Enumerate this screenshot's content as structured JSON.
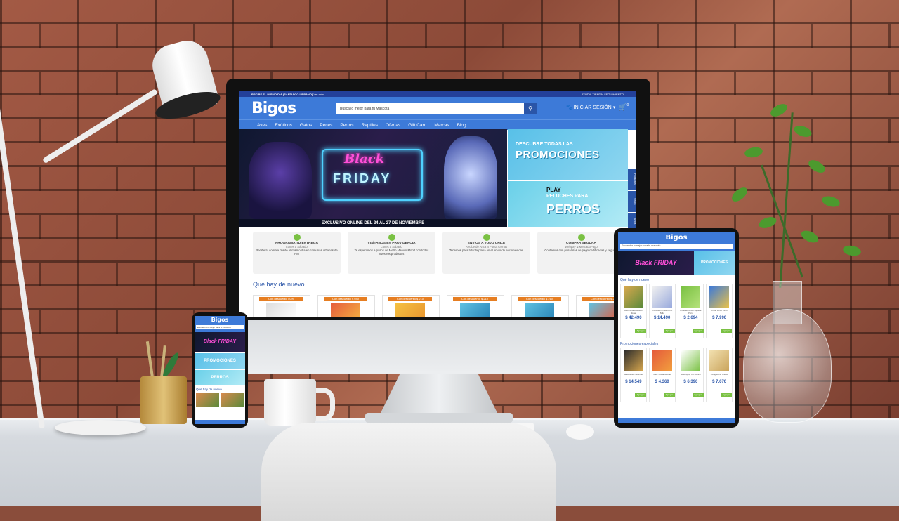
{
  "scene": {
    "background": "brick-wall",
    "accent": "#3d7ad8",
    "nav_dark": "#23409a",
    "cta_green": "#7ac143",
    "badge_orange": "#e67e22"
  },
  "desktop": {
    "topbar": {
      "left": "RECIBE EL MISMO DÍA (SANTIAGO URBANO)",
      "left_link": "Ver más",
      "help": "AYUDA",
      "store": "TIENDA",
      "tracking": "SEGUIMIENTO"
    },
    "header": {
      "logo": "Bigos",
      "search_placeholder": "Busca lo mejor para tu Mascota",
      "search_icon": "search-icon",
      "login": "INICIAR SESIÓN",
      "cart_icon": "cart-icon",
      "cart_count": "0"
    },
    "nav": [
      "Aves",
      "Exóticos",
      "Gatos",
      "Peces",
      "Perros",
      "Reptiles",
      "Ofertas",
      "Gift Card",
      "Marcas",
      "Blog"
    ],
    "hero": {
      "black": "Black",
      "friday": "FRIDAY",
      "strip": "EXCLUSIVO ONLINE DEL 24 AL 27 DE NOVIEMBRE"
    },
    "promo1": {
      "line1": "DESCUBRE TODAS LAS",
      "line2": "PROMOCIONES"
    },
    "promo2": {
      "brand": "PLAY",
      "line1": "PELUCHES PARA",
      "line2": "PERROS"
    },
    "side_tabs": [
      "Productos",
      "Vistos",
      "Arriba"
    ],
    "info": [
      {
        "icon": "clock-icon",
        "title": "PROGRAMA TU ENTREGA",
        "sub": "Lunes a Sábado",
        "desc": "Recibe tu compra desde el mismo día en comunas urbanas de RM"
      },
      {
        "icon": "store-icon",
        "title": "VISÍTANOS EN PROVIDENCIA",
        "sub": "Lunes a Sábado",
        "desc": "Te esperamos a pasos de Metro Manuel Montt con todos nuestros productos"
      },
      {
        "icon": "truck-icon",
        "title": "ENVÍOS A TODO CHILE",
        "sub": "Recibe de Arica a Punta Arenas",
        "desc": "Tenemos para ti tarifa plana en el envío de encomiendas"
      },
      {
        "icon": "lock-icon",
        "title": "COMPRA SEGURA",
        "sub": "Webpay & MercadoPago",
        "desc": "Contamos con pasarelas de pago certificadas y seguras"
      }
    ],
    "section_title": "Qué hay de nuevo",
    "products": [
      {
        "badge": "Con descuento 50%"
      },
      {
        "badge": "Con descuento $ 690"
      },
      {
        "badge": "Con descuento $ 210"
      },
      {
        "badge": "Con descuento $ 210"
      },
      {
        "badge": "Con descuento $ 210"
      },
      {
        "badge": "Con descuento $ 210"
      }
    ]
  },
  "tablet": {
    "logo": "Bigos",
    "search_placeholder": "Encuentra lo mejor para tu mascota",
    "hero_text": "Black FRIDAY",
    "promo_text": "PROMOCIONES",
    "section1": "Qué hay de nuevo",
    "section2": "Promociones especiales",
    "row1": [
      {
        "name": "Gato Tabla Rascador Zona",
        "price": "$ 42.490",
        "button": "Agregar"
      },
      {
        "name": "TropiClean Tratamiento Brillo",
        "price": "$ 14.490",
        "button": "Agregar"
      },
      {
        "name": "Pruebas Dental Juguete Perro",
        "price": "$ 2.694",
        "button": "Agregar"
      },
      {
        "name": "Prudo Fonto Perro",
        "price": "$ 7.990",
        "button": "Agregar"
      }
    ],
    "row2": [
      {
        "name": "Seed Snack Gourmet",
        "price": "$ 14.549",
        "button": "Agregar"
      },
      {
        "name": "Gato Tablita Natural",
        "price": "$ 4.360",
        "button": "Agregar"
      },
      {
        "name": "Gato Spray 3.8 Control",
        "price": "$ 6.390",
        "button": "Agregar"
      },
      {
        "name": "Living World Chews",
        "price": "$ 7.670",
        "button": "Agregar"
      }
    ]
  },
  "phone": {
    "logo": "Bigos",
    "search_placeholder": "Encuentra lo mejor para tu mascota",
    "hero_text": "Black FRIDAY",
    "promo_text": "PROMOCIONES",
    "perros_text": "PERROS",
    "section": "Qué hay de nuevo"
  }
}
